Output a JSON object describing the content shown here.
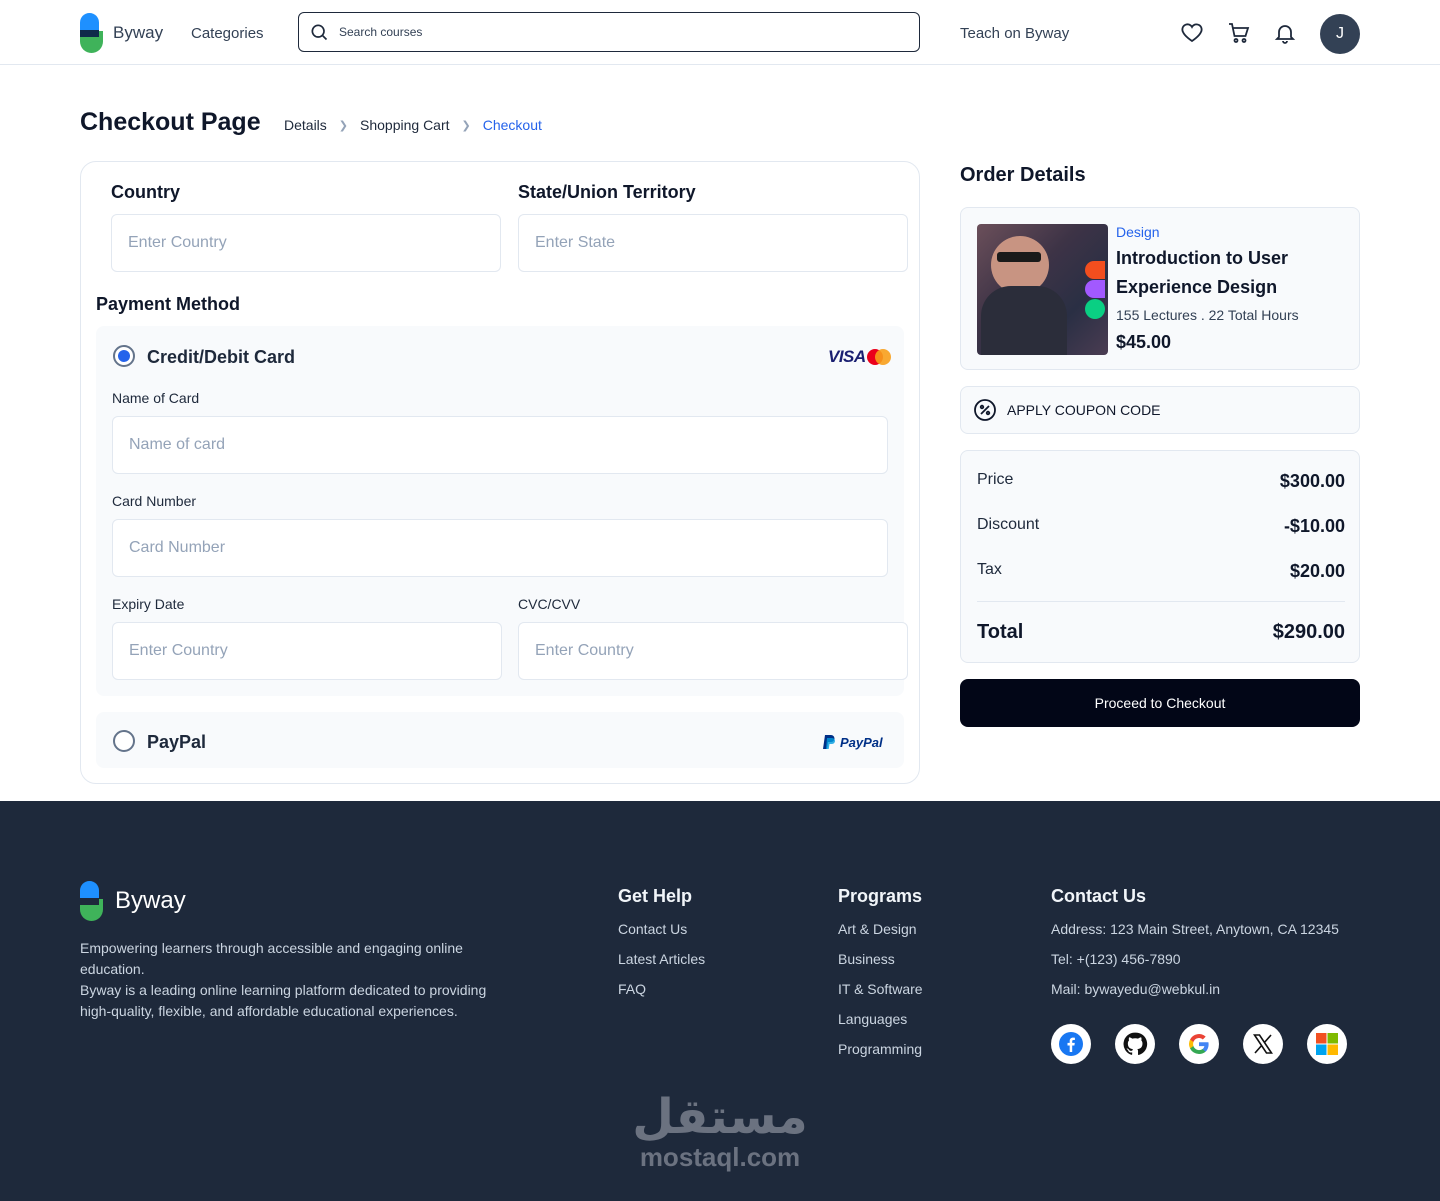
{
  "header": {
    "brand": "Byway",
    "categories_label": "Categories",
    "search_placeholder": "Search courses",
    "teach_label": "Teach on Byway",
    "avatar_initial": "J"
  },
  "page": {
    "title": "Checkout Page",
    "breadcrumb": [
      "Details",
      "Shopping Cart",
      "Checkout"
    ]
  },
  "form": {
    "country_label": "Country",
    "country_placeholder": "Enter Country",
    "state_label": "State/Union Territory",
    "state_placeholder": "Enter State",
    "payment_method_label": "Payment Method",
    "card_option_label": "Credit/Debit Card",
    "card_brand_text": "VISA",
    "name_label": "Name of Card",
    "name_placeholder": "Name of card",
    "number_label": "Card Number",
    "number_placeholder": "Card Number",
    "expiry_label": "Expiry Date",
    "expiry_placeholder": "Enter Country",
    "cvc_label": "CVC/CVV",
    "cvc_placeholder": "Enter Country",
    "paypal_option_label": "PayPal",
    "paypal_logo_text": "PayPal",
    "selected_method": "card"
  },
  "order": {
    "title": "Order Details",
    "course": {
      "category": "Design",
      "name": "Introduction to User Experience Design",
      "meta": "155 Lectures . 22 Total Hours",
      "price": "$45.00"
    },
    "coupon_label": "APPLY COUPON CODE",
    "summary": [
      {
        "label": "Price",
        "value": "$300.00"
      },
      {
        "label": "Discount",
        "value": "-$10.00"
      },
      {
        "label": "Tax",
        "value": "$20.00"
      }
    ],
    "total_label": "Total",
    "total_value": "$290.00",
    "checkout_button": "Proceed to Checkout"
  },
  "footer": {
    "brand": "Byway",
    "description_1": "Empowering learners through accessible and engaging online education.",
    "description_2": "Byway is a leading online learning platform dedicated to providing high-quality, flexible, and affordable educational experiences.",
    "get_help": {
      "title": "Get Help",
      "links": [
        "Contact Us",
        "Latest Articles",
        "FAQ"
      ]
    },
    "programs": {
      "title": "Programs",
      "links": [
        "Art & Design",
        "Business",
        "IT & Software",
        "Languages",
        "Programming"
      ]
    },
    "contact": {
      "title": "Contact Us",
      "address": "Address: 123 Main Street, Anytown, CA 12345",
      "tel": "Tel: +(123) 456-7890",
      "mail": "Mail: bywayedu@webkul.in"
    },
    "social_icons": [
      "facebook-icon",
      "github-icon",
      "google-icon",
      "x-icon",
      "microsoft-icon"
    ]
  },
  "watermark": {
    "arabic": "مستقل",
    "latin": "mostaql.com"
  },
  "colors": {
    "accent": "#2563eb",
    "footer_bg": "#1e293b",
    "button_bg": "#020617"
  }
}
